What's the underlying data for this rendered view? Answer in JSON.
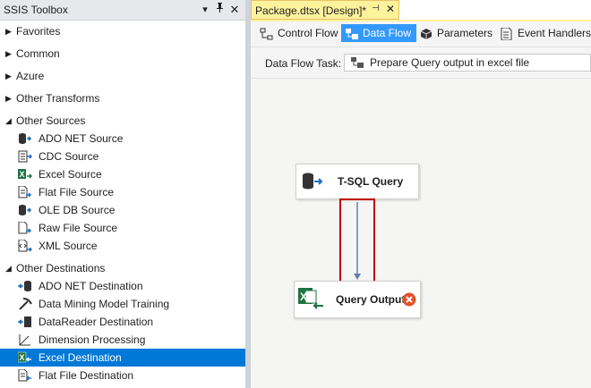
{
  "toolbox": {
    "title": "SSIS Toolbox",
    "sections": {
      "favorites": "Favorites",
      "common": "Common",
      "azure": "Azure",
      "other_transforms": "Other Transforms",
      "other_sources": "Other Sources",
      "other_destinations": "Other Destinations"
    },
    "sources": [
      "ADO NET Source",
      "CDC Source",
      "Excel Source",
      "Flat File Source",
      "OLE DB Source",
      "Raw File Source",
      "XML Source"
    ],
    "destinations": [
      "ADO NET Destination",
      "Data Mining Model Training",
      "DataReader Destination",
      "Dimension Processing",
      "Excel Destination",
      "Flat File Destination"
    ],
    "selected": "Excel Destination"
  },
  "document": {
    "tab_title": "Package.dtsx [Design]*",
    "tabs": [
      "Control Flow",
      "Data Flow",
      "Parameters",
      "Event Handlers"
    ],
    "active_tab": "Data Flow",
    "dft_label": "Data Flow Task:",
    "dft_value": "Prepare Query output in excel file"
  },
  "canvas": {
    "source_component": "T-SQL Query",
    "destination_component": "Query Output"
  },
  "colors": {
    "selection": "#0078d7",
    "active_tab": "#3399ff",
    "doc_tab": "#fff29d",
    "highlight_box": "#c00000",
    "error": "#e0522b"
  }
}
